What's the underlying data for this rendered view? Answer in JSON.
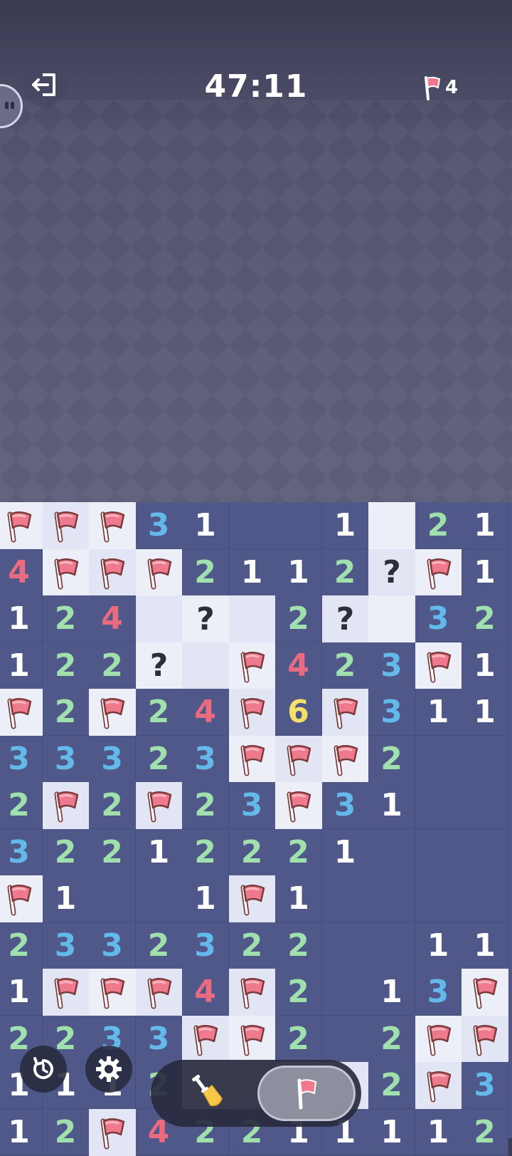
{
  "header": {
    "timer": "47:11",
    "flags_remaining": "4"
  },
  "icons": {
    "exit": "exit-door-icon",
    "restart": "restart-icon",
    "settings": "gear-icon",
    "dig": "shovel-icon",
    "flag": "flag-icon"
  },
  "colors": {
    "open_cell": "#4f5888",
    "closed_cell": "#eceef8",
    "num_1": "#ffffff",
    "num_2": "#9fe0ad",
    "num_3": "#62b9ea",
    "num_4": "#ea6a80",
    "num_6": "#f4e06a",
    "flag": "#ef7a8e"
  },
  "mode": {
    "selected": "flag"
  },
  "board": {
    "rows": [
      [
        "F",
        "F",
        "F",
        "3",
        "1",
        "0",
        "0",
        "1",
        "C",
        "2",
        "1"
      ],
      [
        "4",
        "F",
        "F",
        "F",
        "2",
        "1",
        "1",
        "2",
        "?",
        "F",
        "1"
      ],
      [
        "1",
        "2",
        "4",
        "C",
        "?",
        "C",
        "2",
        "?",
        "C",
        "3",
        "2"
      ],
      [
        "1",
        "2",
        "2",
        "?",
        "C",
        "F",
        "4",
        "2",
        "3",
        "F",
        "1"
      ],
      [
        "F",
        "2",
        "F",
        "2",
        "4",
        "F",
        "6",
        "F",
        "3",
        "1",
        "1"
      ],
      [
        "3",
        "3",
        "3",
        "2",
        "3",
        "F",
        "F",
        "F",
        "2",
        "0",
        "0"
      ],
      [
        "2",
        "F",
        "2",
        "F",
        "2",
        "3",
        "F",
        "3",
        "1",
        "0",
        "0"
      ],
      [
        "3",
        "2",
        "2",
        "1",
        "2",
        "2",
        "2",
        "1",
        "0",
        "0",
        "0"
      ],
      [
        "F",
        "1",
        "0",
        "0",
        "1",
        "F",
        "1",
        "0",
        "0",
        "0",
        "0"
      ],
      [
        "2",
        "3",
        "3",
        "2",
        "3",
        "2",
        "2",
        "0",
        "0",
        "1",
        "1"
      ],
      [
        "1",
        "F",
        "F",
        "F",
        "4",
        "F",
        "2",
        "0",
        "1",
        "3",
        "F"
      ],
      [
        "2",
        "2",
        "3",
        "3",
        "F",
        "F",
        "2",
        "0",
        "2",
        "F",
        "F"
      ],
      [
        "1",
        "1",
        "1",
        "2",
        "C",
        "C",
        "C",
        "C",
        "2",
        "F",
        "3"
      ],
      [
        "1",
        "2",
        "F",
        "4",
        "2",
        "2",
        "1",
        "1",
        "1",
        "1",
        "2"
      ]
    ]
  }
}
